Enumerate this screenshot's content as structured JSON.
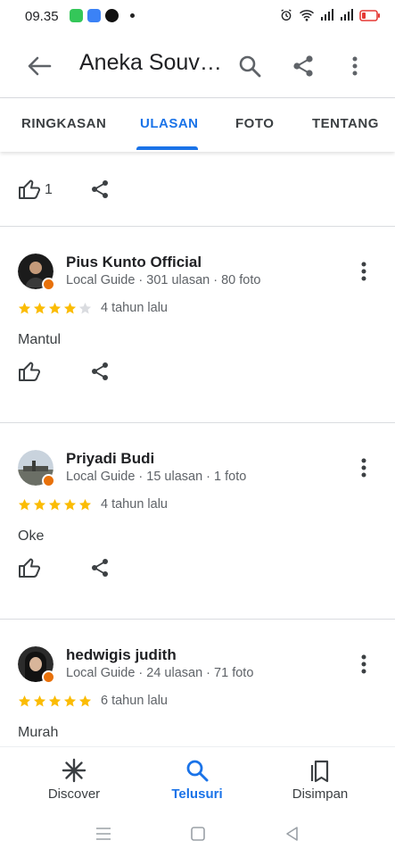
{
  "status_bar": {
    "time": "09.35",
    "battery_color": "#e53935"
  },
  "app_bar": {
    "title": "Aneka Souvenir",
    "icons": [
      "back-arrow-icon",
      "search-icon",
      "share-icon",
      "more-vert-icon"
    ]
  },
  "tabs": [
    {
      "label": "RINGKASAN",
      "active": false
    },
    {
      "label": "ULASAN",
      "active": true
    },
    {
      "label": "FOTO",
      "active": false
    },
    {
      "label": "TENTANG",
      "active": false
    }
  ],
  "top_actions": {
    "like_count": "1"
  },
  "reviews": [
    {
      "name": "Pius Kunto Official",
      "meta": "Local Guide · 301 ulasan · 80 foto",
      "rating": 4,
      "time": "4 tahun lalu",
      "text": "Mantul"
    },
    {
      "name": "Priyadi Budi",
      "meta": "Local Guide · 15 ulasan · 1 foto",
      "rating": 5,
      "time": "4 tahun lalu",
      "text": "Oke"
    },
    {
      "name": "hedwigis judith",
      "meta": "Local Guide · 24 ulasan · 71 foto",
      "rating": 5,
      "time": "6 tahun lalu",
      "text": "Murah"
    }
  ],
  "bottom_nav": [
    {
      "label": "Discover",
      "icon": "discover-icon",
      "active": false
    },
    {
      "label": "Telusuri",
      "icon": "search-icon",
      "active": true
    },
    {
      "label": "Disimpan",
      "icon": "bookmarks-icon",
      "active": false
    }
  ],
  "colors": {
    "accent": "#1a73e8",
    "star": "#fbbc04",
    "star_empty": "#dadce0",
    "local_guide_badge": "#e8710a"
  }
}
